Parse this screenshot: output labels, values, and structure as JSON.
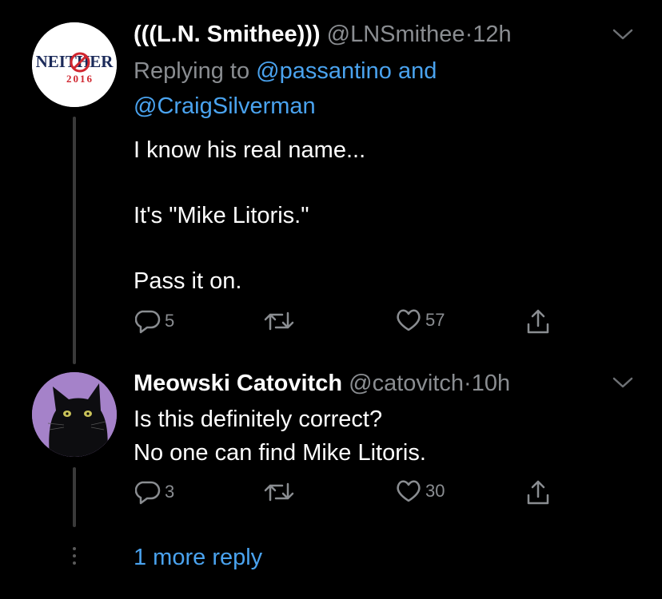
{
  "colors": {
    "background": "#000000",
    "link": "#4aa3ef",
    "muted": "#8a8d91",
    "text": "#ffffff"
  },
  "tweets": [
    {
      "display_name": "(((L.N. Smithee)))",
      "handle": "@LNSmithee",
      "separator": "·",
      "time": "12h",
      "replying_prefix": "Replying to",
      "reply_mention_1": "@passantino",
      "reply_and": "and",
      "reply_mention_2": "@CraigSilverman",
      "avatar_text_top": "NEITHER",
      "avatar_text_bottom": "2016",
      "body": [
        "I know his real name...",
        "It's \"Mike Litoris.\"",
        "Pass it on."
      ],
      "replies": "5",
      "retweets": "",
      "likes": "57"
    },
    {
      "display_name": "Meowski Catovitch",
      "handle": "@catovitch",
      "separator": "·",
      "time": "10h",
      "avatar_icon": "black-cat-avatar",
      "body": [
        "Is this definitely correct?",
        "No one can find Mike Litoris."
      ],
      "replies": "3",
      "retweets": "",
      "likes": "30"
    }
  ],
  "more_replies_label": "1 more reply"
}
